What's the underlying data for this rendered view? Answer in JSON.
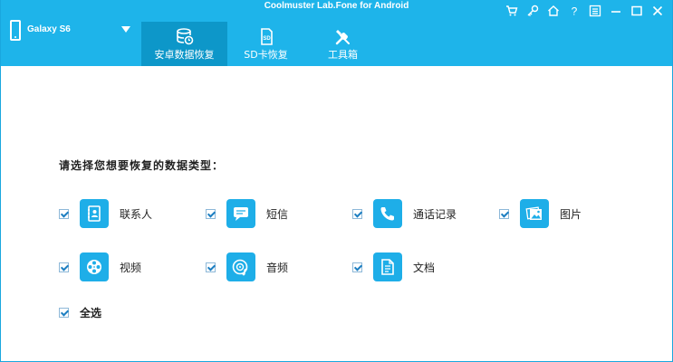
{
  "window": {
    "title": "Coolmuster Lab.Fone for Android"
  },
  "device": {
    "name": "Galaxy S6"
  },
  "nav": {
    "tabs": [
      {
        "label": "安卓数据恢复",
        "icon": "database-restore-icon",
        "active": true
      },
      {
        "label": "SD卡恢复",
        "icon": "sd-card-icon",
        "active": false
      },
      {
        "label": "工具箱",
        "icon": "tools-icon",
        "active": false
      }
    ]
  },
  "window_controls": [
    "cart-icon",
    "key-icon",
    "home-icon",
    "help-icon",
    "menu-icon",
    "minimize-icon",
    "maximize-icon",
    "close-icon"
  ],
  "help_glyph": "?",
  "main": {
    "prompt": "请选择您想要恢复的数据类型：",
    "types": [
      {
        "label": "联系人",
        "icon": "contacts-icon",
        "checked": true
      },
      {
        "label": "短信",
        "icon": "sms-icon",
        "checked": true
      },
      {
        "label": "通话记录",
        "icon": "phone-icon",
        "checked": true
      },
      {
        "label": "图片",
        "icon": "photos-icon",
        "checked": true
      },
      {
        "label": "视频",
        "icon": "video-reel-icon",
        "checked": true
      },
      {
        "label": "音频",
        "icon": "audio-icon",
        "checked": true
      },
      {
        "label": "文档",
        "icon": "document-icon",
        "checked": true
      }
    ],
    "select_all": {
      "label": "全选",
      "checked": true
    }
  },
  "colors": {
    "header": "#1eb4ea",
    "active_tab": "#0d97c9",
    "icon_box": "#1eaee8"
  }
}
